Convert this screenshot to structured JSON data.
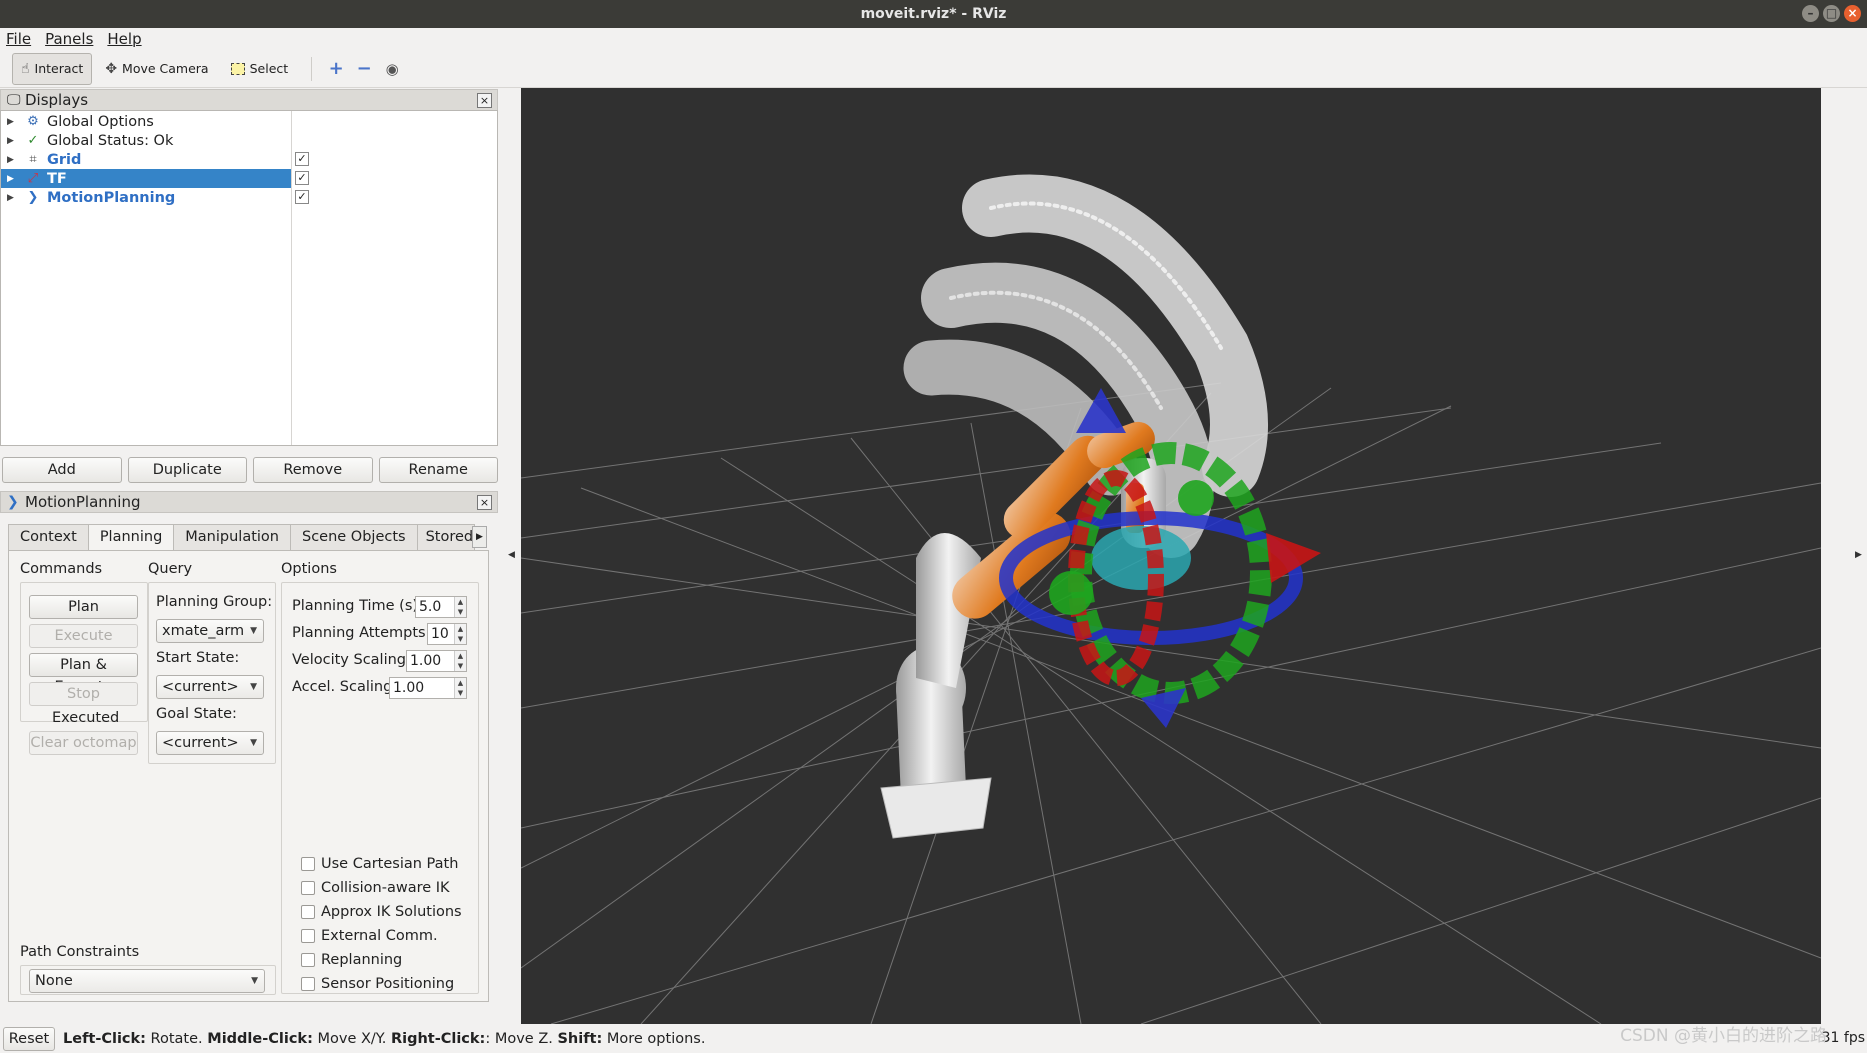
{
  "window": {
    "title": "moveit.rviz* - RViz"
  },
  "menu": {
    "items": [
      {
        "label": "File"
      },
      {
        "label": "Panels"
      },
      {
        "label": "Help"
      }
    ]
  },
  "toolbar": {
    "interact": "Interact",
    "move_camera": "Move Camera",
    "select": "Select"
  },
  "displays": {
    "title": "Displays",
    "rows": [
      {
        "label": "Global Options"
      },
      {
        "label": "Global Status: Ok"
      },
      {
        "label": "Grid",
        "checked": true
      },
      {
        "label": "TF",
        "checked": true,
        "selected": true
      },
      {
        "label": "MotionPlanning",
        "checked": true
      }
    ],
    "buttons": {
      "add": "Add",
      "duplicate": "Duplicate",
      "remove": "Remove",
      "rename": "Rename"
    }
  },
  "motion_planning": {
    "title": "MotionPlanning",
    "tabs": [
      {
        "label": "Context"
      },
      {
        "label": "Planning",
        "active": true
      },
      {
        "label": "Manipulation"
      },
      {
        "label": "Scene Objects"
      },
      {
        "label": "Stored"
      }
    ],
    "commands": {
      "title": "Commands",
      "plan": "Plan",
      "execute": "Execute",
      "plan_execute": "Plan & Execute",
      "stop": "Stop",
      "status": "Executed",
      "clear_octomap": "Clear octomap"
    },
    "query": {
      "title": "Query",
      "planning_group_label": "Planning Group:",
      "planning_group": "xmate_arm",
      "start_state_label": "Start State:",
      "start_state": "<current>",
      "goal_state_label": "Goal State:",
      "goal_state": "<current>"
    },
    "options": {
      "title": "Options",
      "planning_time_label": "Planning Time (s):",
      "planning_time": "5.0",
      "planning_attempts_label": "Planning Attempts:",
      "planning_attempts": "10",
      "velocity_scaling_label": "Velocity Scaling:",
      "velocity_scaling": "1.00",
      "accel_scaling_label": "Accel. Scaling:",
      "accel_scaling": "1.00",
      "checkboxes": [
        {
          "label": "Use Cartesian Path",
          "checked": false
        },
        {
          "label": "Collision-aware IK",
          "checked": false
        },
        {
          "label": "Approx IK Solutions",
          "checked": false
        },
        {
          "label": "External Comm.",
          "checked": false
        },
        {
          "label": "Replanning",
          "checked": false
        },
        {
          "label": "Sensor Positioning",
          "checked": false
        }
      ]
    },
    "path_constraints": {
      "title": "Path Constraints",
      "value": "None"
    }
  },
  "status": {
    "reset": "Reset",
    "hint_left_key": "Left-Click:",
    "hint_left": " Rotate. ",
    "hint_middle_key": "Middle-Click:",
    "hint_middle": " Move X/Y. ",
    "hint_right_key": "Right-Click:",
    "hint_right": ": Move Z. ",
    "hint_shift_key": "Shift:",
    "hint_shift": " More options.",
    "fps": "31 fps"
  },
  "watermark": "CSDN @黄小白的进阶之路",
  "colors": {
    "selection": "#3584c8",
    "link_blue": "#2f6fc4",
    "viewport_bg": "#303030",
    "titlebar": "#3b3b37"
  }
}
